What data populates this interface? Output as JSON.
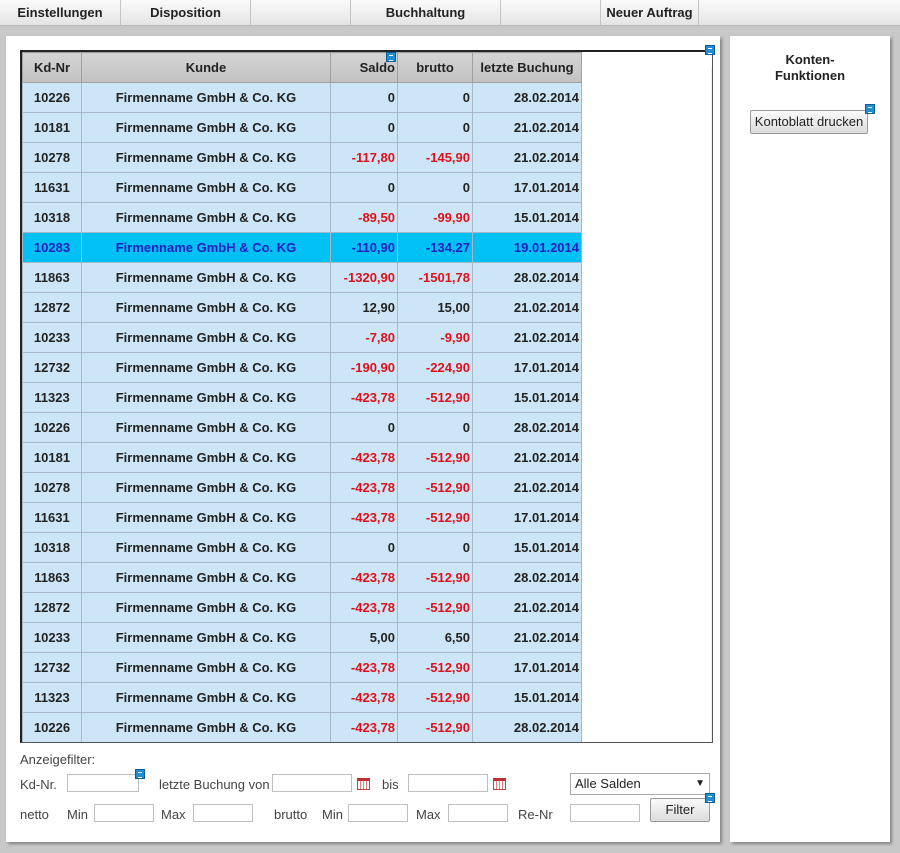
{
  "menu": {
    "items": [
      "Einstellungen",
      "Disposition",
      "",
      "Buchhaltung",
      "",
      "Neuer Auftrag"
    ]
  },
  "grid": {
    "headers": [
      "Kd-Nr",
      "Kunde",
      "Saldo",
      "brutto",
      "letzte Buchung"
    ],
    "selected_row": 5,
    "rows": [
      {
        "kdnr": "10226",
        "kunde": "Firmenname GmbH & Co. KG",
        "saldo": "0",
        "brutto": "0",
        "date": "28.02.2014"
      },
      {
        "kdnr": "10181",
        "kunde": "Firmenname GmbH & Co. KG",
        "saldo": "0",
        "brutto": "0",
        "date": "21.02.2014"
      },
      {
        "kdnr": "10278",
        "kunde": "Firmenname GmbH & Co. KG",
        "saldo": "-117,80",
        "brutto": "-145,90",
        "date": "21.02.2014"
      },
      {
        "kdnr": "11631",
        "kunde": "Firmenname GmbH & Co. KG",
        "saldo": "0",
        "brutto": "0",
        "date": "17.01.2014"
      },
      {
        "kdnr": "10318",
        "kunde": "Firmenname GmbH & Co. KG",
        "saldo": "-89,50",
        "brutto": "-99,90",
        "date": "15.01.2014"
      },
      {
        "kdnr": "10283",
        "kunde": "Firmenname GmbH & Co. KG",
        "saldo": "-110,90",
        "brutto": "-134,27",
        "date": "19.01.2014"
      },
      {
        "kdnr": "11863",
        "kunde": "Firmenname GmbH & Co. KG",
        "saldo": "-1320,90",
        "brutto": "-1501,78",
        "date": "28.02.2014"
      },
      {
        "kdnr": "12872",
        "kunde": "Firmenname GmbH & Co. KG",
        "saldo": "12,90",
        "brutto": "15,00",
        "date": "21.02.2014"
      },
      {
        "kdnr": "10233",
        "kunde": "Firmenname GmbH & Co. KG",
        "saldo": "-7,80",
        "brutto": "-9,90",
        "date": "21.02.2014"
      },
      {
        "kdnr": "12732",
        "kunde": "Firmenname GmbH & Co. KG",
        "saldo": "-190,90",
        "brutto": "-224,90",
        "date": "17.01.2014"
      },
      {
        "kdnr": "11323",
        "kunde": "Firmenname GmbH & Co. KG",
        "saldo": "-423,78",
        "brutto": "-512,90",
        "date": "15.01.2014"
      },
      {
        "kdnr": "10226",
        "kunde": "Firmenname GmbH & Co. KG",
        "saldo": "0",
        "brutto": "0",
        "date": "28.02.2014"
      },
      {
        "kdnr": "10181",
        "kunde": "Firmenname GmbH & Co. KG",
        "saldo": "-423,78",
        "brutto": "-512,90",
        "date": "21.02.2014"
      },
      {
        "kdnr": "10278",
        "kunde": "Firmenname GmbH & Co. KG",
        "saldo": "-423,78",
        "brutto": "-512,90",
        "date": "21.02.2014"
      },
      {
        "kdnr": "11631",
        "kunde": "Firmenname GmbH & Co. KG",
        "saldo": "-423,78",
        "brutto": "-512,90",
        "date": "17.01.2014"
      },
      {
        "kdnr": "10318",
        "kunde": "Firmenname GmbH & Co. KG",
        "saldo": "0",
        "brutto": "0",
        "date": "15.01.2014"
      },
      {
        "kdnr": "11863",
        "kunde": "Firmenname GmbH & Co. KG",
        "saldo": "-423,78",
        "brutto": "-512,90",
        "date": "28.02.2014"
      },
      {
        "kdnr": "12872",
        "kunde": "Firmenname GmbH & Co. KG",
        "saldo": "-423,78",
        "brutto": "-512,90",
        "date": "21.02.2014"
      },
      {
        "kdnr": "10233",
        "kunde": "Firmenname GmbH & Co. KG",
        "saldo": "5,00",
        "brutto": "6,50",
        "date": "21.02.2014"
      },
      {
        "kdnr": "12732",
        "kunde": "Firmenname GmbH & Co. KG",
        "saldo": "-423,78",
        "brutto": "-512,90",
        "date": "17.01.2014"
      },
      {
        "kdnr": "11323",
        "kunde": "Firmenname GmbH & Co. KG",
        "saldo": "-423,78",
        "brutto": "-512,90",
        "date": "15.01.2014"
      },
      {
        "kdnr": "10226",
        "kunde": "Firmenname GmbH & Co. KG",
        "saldo": "-423,78",
        "brutto": "-512,90",
        "date": "28.02.2014"
      }
    ]
  },
  "filter": {
    "title": "Anzeigefilter:",
    "kdnr_label": "Kd-Nr.",
    "kdnr_value": "",
    "letzte_buchung_label": "letzte Buchung von",
    "von_value": "",
    "bis_label": "bis",
    "bis_value": "",
    "salden_select": "Alle Salden",
    "netto_label": "netto",
    "min_label": "Min",
    "max_label": "Max",
    "brutto_label": "brutto",
    "renr_label": "Re-Nr",
    "filter_button": "Filter"
  },
  "side": {
    "title_line1": "Konten-",
    "title_line2": "Funktionen",
    "print_button": "Kontoblatt drucken"
  },
  "colors": {
    "row_bg": "#cde6f7",
    "selected_bg": "#00c0f4",
    "negative": "#e0101a",
    "selected_text": "#2020c0"
  },
  "icons": [
    "note-icon",
    "calendar-icon",
    "chevron-down-icon",
    "scroll-up-icon",
    "scroll-down-icon"
  ]
}
